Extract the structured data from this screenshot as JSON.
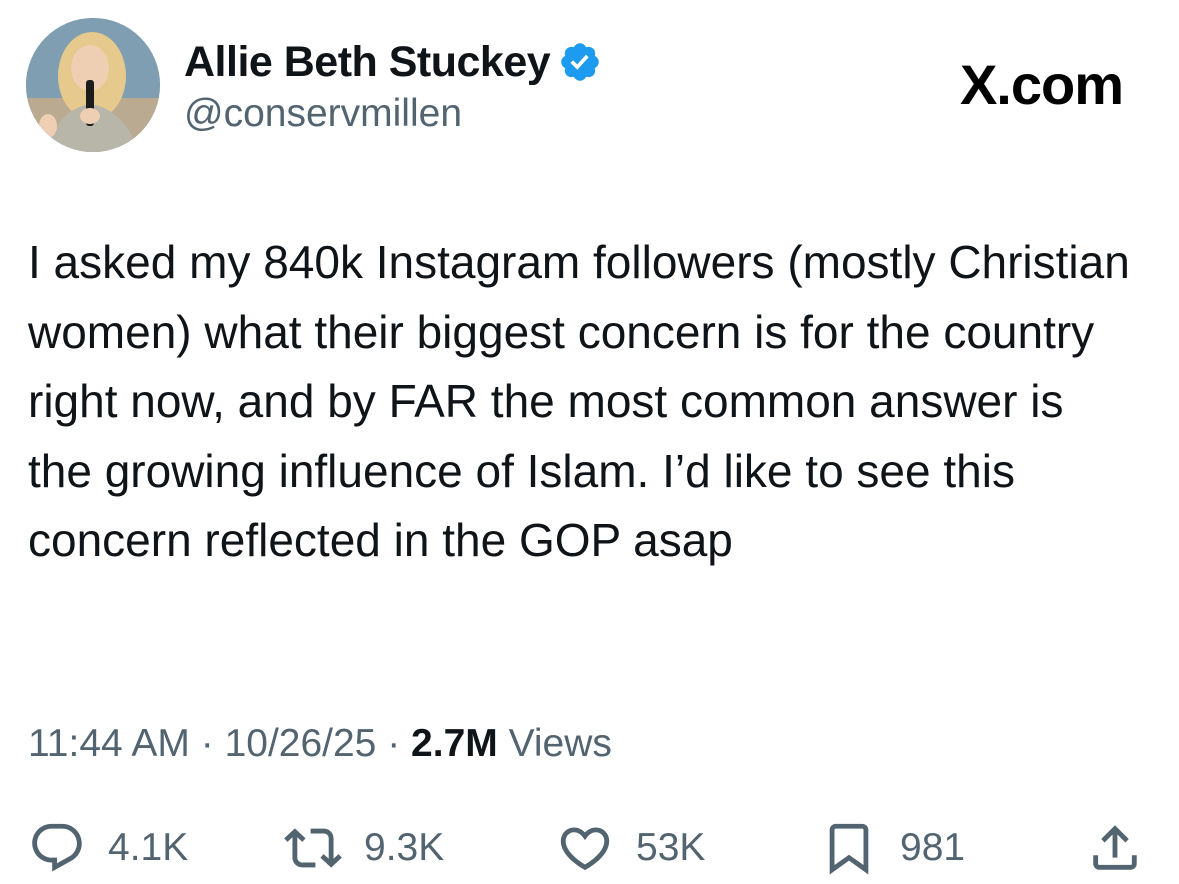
{
  "author": {
    "display_name": "Allie Beth Stuckey",
    "handle": "@conservmillen",
    "verified_icon": "verified-badge-icon",
    "avatar_icon": "profile-photo",
    "verified_color": "#1d9bf0"
  },
  "brand": {
    "label": "X.com"
  },
  "tweet": {
    "text": "I asked my 840k Instagram followers (mostly Christian women) what their biggest concern is for the country right now, and by FAR the most common answer is the growing influence of Islam. I’d like to see this concern reflected in the GOP asap"
  },
  "meta": {
    "time": "11:44 AM",
    "separator": " · ",
    "date": "10/26/25",
    "views_count": "2.7M",
    "views_label": " Views"
  },
  "actions": {
    "reply": {
      "icon": "reply-icon",
      "count": "4.1K"
    },
    "repost": {
      "icon": "repost-icon",
      "count": "9.3K"
    },
    "like": {
      "icon": "heart-icon",
      "count": "53K"
    },
    "bookmark": {
      "icon": "bookmark-icon",
      "count": "981"
    },
    "share": {
      "icon": "share-icon"
    }
  },
  "colors": {
    "text_primary": "#0f1419",
    "text_secondary": "#536471",
    "icon": "#536471"
  }
}
